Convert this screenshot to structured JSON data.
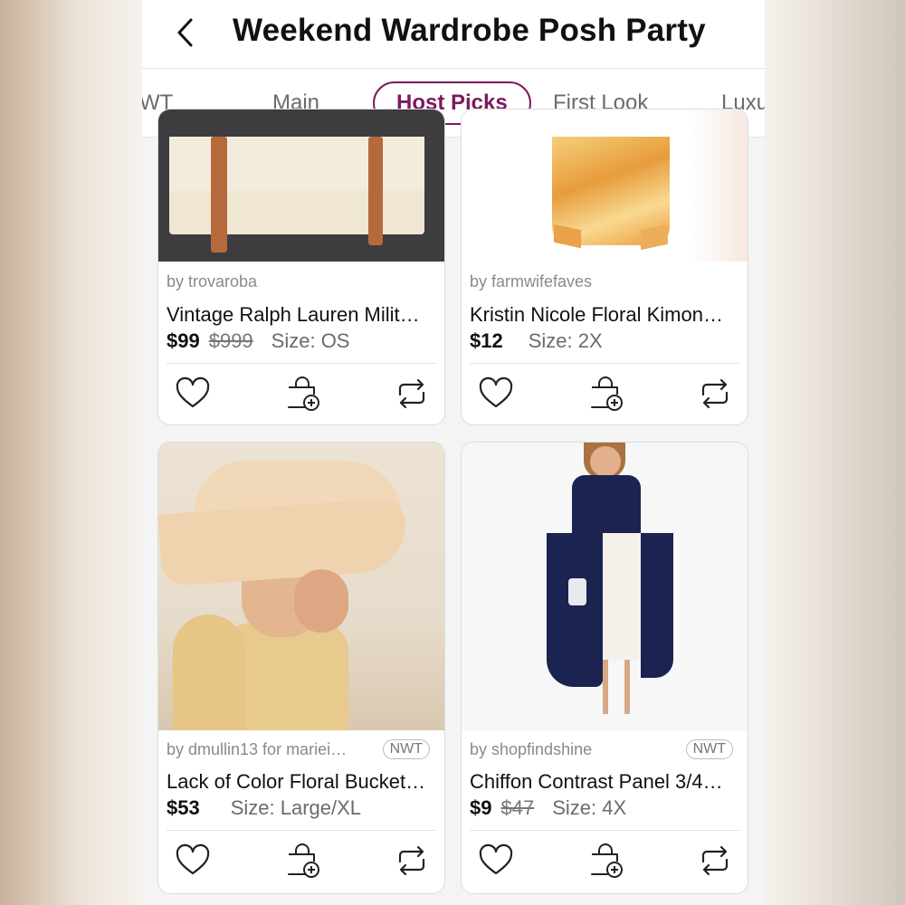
{
  "header": {
    "title": "Weekend Wardrobe Posh Party",
    "back_icon": "chevron-left-icon"
  },
  "tabs": [
    {
      "label": "WT",
      "active": false
    },
    {
      "label": "Main",
      "active": false
    },
    {
      "label": "Host Picks",
      "active": true
    },
    {
      "label": "First Look",
      "active": false
    },
    {
      "label": "Luxu",
      "active": false
    }
  ],
  "colors": {
    "accent": "#7b1a5e",
    "text": "#111111",
    "muted": "#8a8a8a"
  },
  "listings": [
    {
      "seller": "by trovaroba",
      "badge": "",
      "name": "Vintage Ralph Lauren Milit…",
      "price": "$99",
      "original_price": "$999",
      "size": "Size: OS"
    },
    {
      "seller": "by farmwifefaves",
      "badge": "",
      "name": "Kristin Nicole Floral Kimon…",
      "price": "$12",
      "original_price": "",
      "size": "Size: 2X"
    },
    {
      "seller": "by dmullin13 for mariei…",
      "badge": "NWT",
      "name": "Lack of Color Floral Bucket…",
      "price": "$53",
      "original_price": "",
      "size": "Size: Large/XL"
    },
    {
      "seller": "by shopfindshine",
      "badge": "NWT",
      "name": "Chiffon Contrast Panel 3/4…",
      "price": "$9",
      "original_price": "$47",
      "size": "Size: 4X"
    }
  ],
  "card_actions": {
    "like_icon": "heart-icon",
    "bundle_icon": "bag-add-icon",
    "share_icon": "share-arrows-icon"
  }
}
